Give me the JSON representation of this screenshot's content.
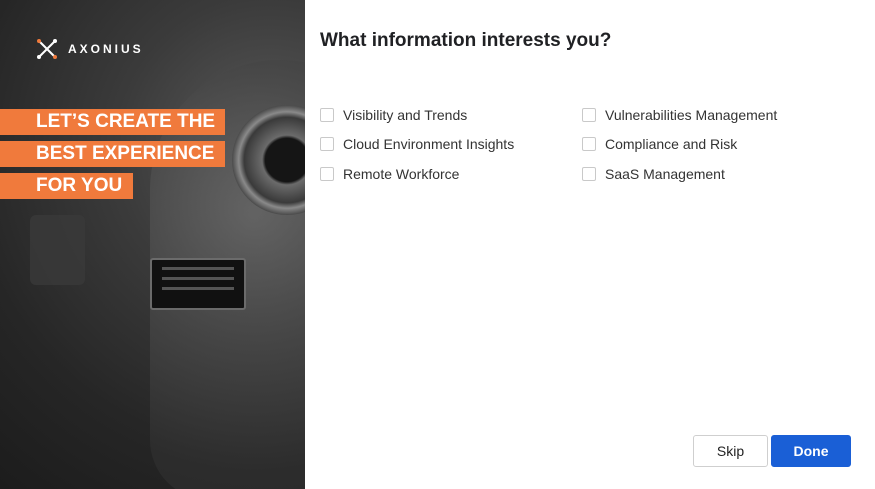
{
  "brand": {
    "logo_text": "AXONIUS",
    "accent_color": "#f07a3c"
  },
  "promo": {
    "line1": "LET’S CREATE THE",
    "line2": "BEST EXPERIENCE",
    "line3": "FOR YOU"
  },
  "title": "What information interests you?",
  "options_left": [
    {
      "label": "Visibility and Trends",
      "checked": false
    },
    {
      "label": "Cloud Environment Insights",
      "checked": false
    },
    {
      "label": "Remote Workforce",
      "checked": false
    }
  ],
  "options_right": [
    {
      "label": "Vulnerabilities Management",
      "checked": false
    },
    {
      "label": "Compliance and Risk",
      "checked": false
    },
    {
      "label": "SaaS Management",
      "checked": false
    }
  ],
  "buttons": {
    "skip": "Skip",
    "done": "Done",
    "primary_color": "#1a5fd6"
  }
}
